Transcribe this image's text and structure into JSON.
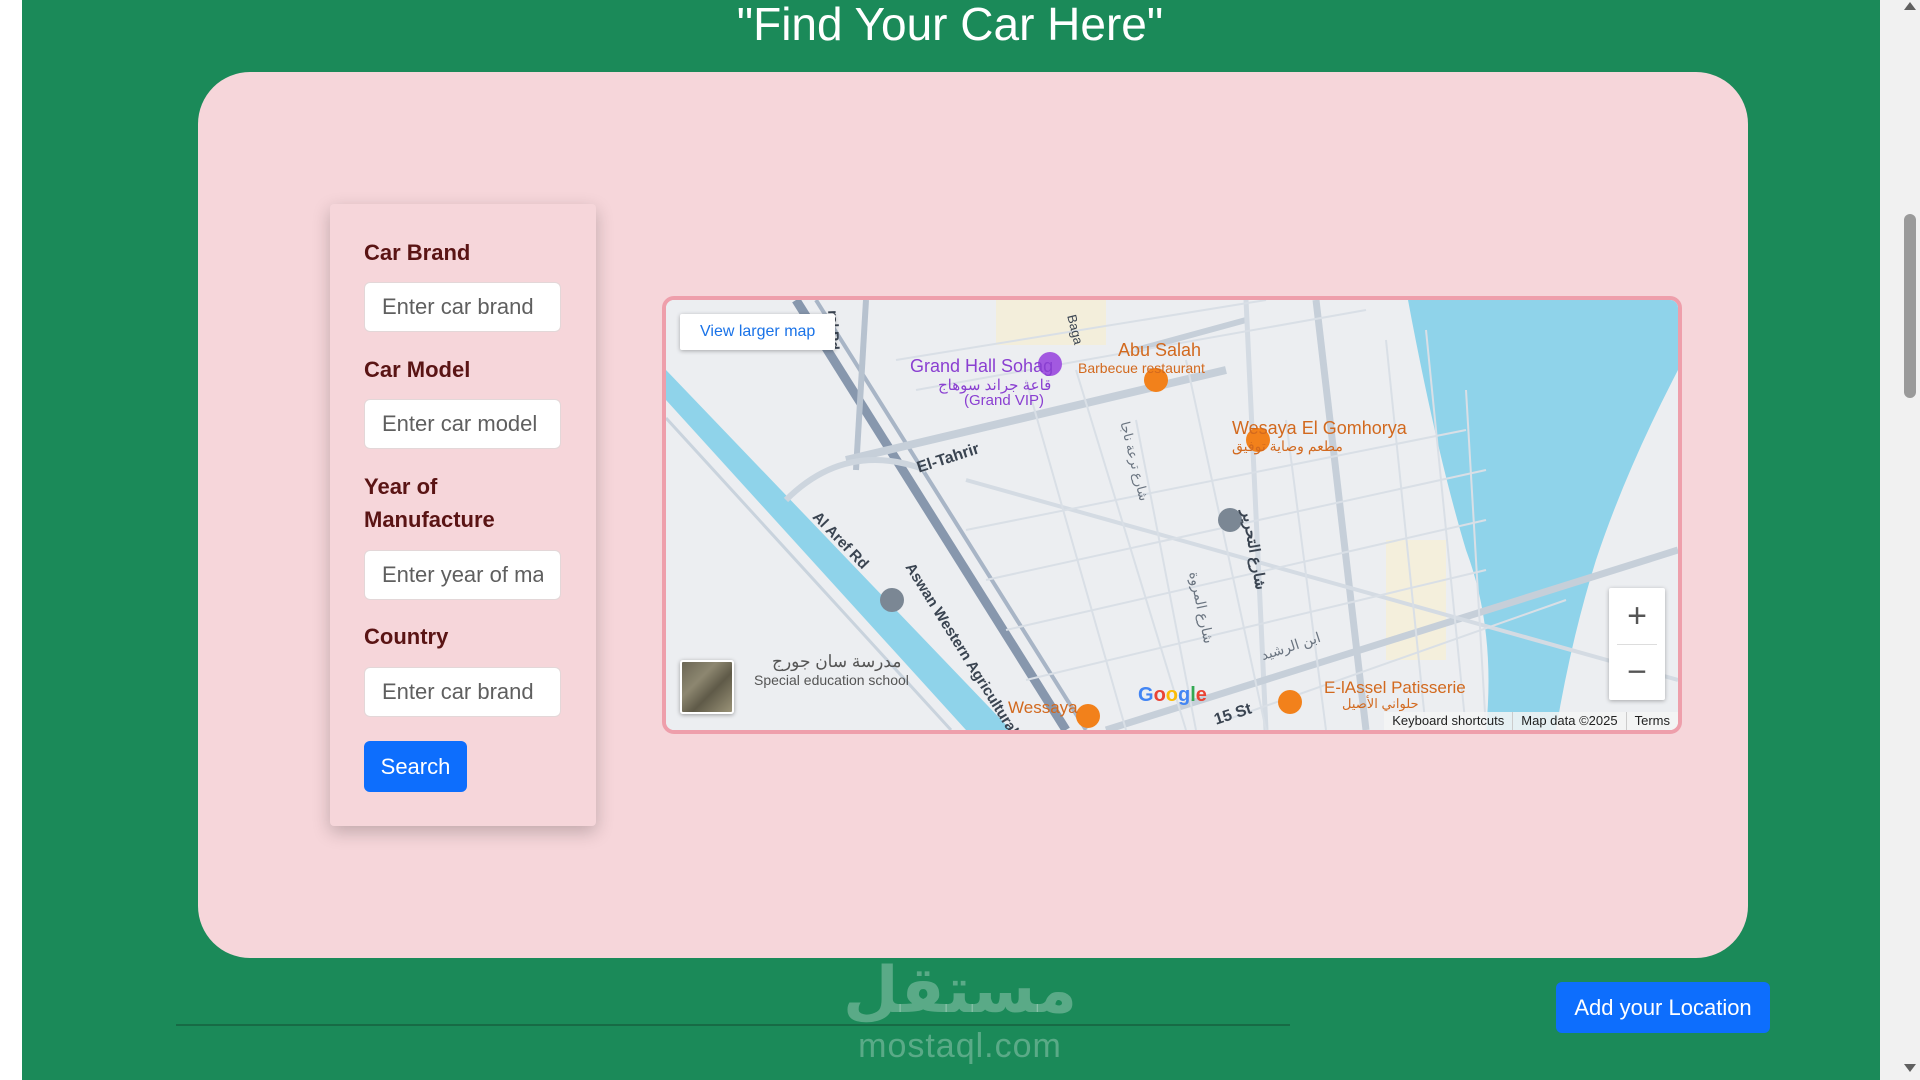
{
  "page": {
    "title": "\"Find Your Car Here\"",
    "bg_color": "#1b8a59",
    "card_color": "#f6d6da"
  },
  "form": {
    "brand_label": "Car Brand",
    "brand_placeholder": "Enter car brand",
    "model_label": "Car Model",
    "model_placeholder": "Enter car model",
    "year_label": "Year of Manufacture",
    "year_placeholder": "Enter year of manufacture",
    "country_label": "Country",
    "country_placeholder": "Enter car brand",
    "search_label": "Search"
  },
  "map": {
    "view_larger": "View larger map",
    "zoom_in": "+",
    "zoom_out": "−",
    "google": "Google",
    "attribution": {
      "keyboard": "Keyboard shortcuts",
      "data": "Map data ©2025",
      "terms": "Terms"
    },
    "places": {
      "grand_hall": "Grand Hall Sohag",
      "grand_hall_ar": "قاعة جراند سوهاج",
      "grand_hall_sub": "(Grand VIP)",
      "abu_salah": "Abu Salah",
      "abu_salah_sub": "Barbecue restaurant",
      "wesaya": "Wesaya El Gomhorya",
      "wesaya_ar": "مطعم وصاية توفيق",
      "school_ar": "مدرسة سان جورج",
      "school": "Special education school",
      "wessaya": "Wessaya",
      "patisserie": "E-lAssel Patisserie",
      "patisserie_ar": "حلواني الأصيل"
    },
    "roads": {
      "el_tahrir": "El-Tahrir",
      "aswan": "Aswan Western Agricultural Rd",
      "al_aref": "Al Aref Rd",
      "st15": "15 St",
      "ral_rd": "ral Rd",
      "baga": "Baga",
      "tahrir_ar": "شارع التحرير",
      "marwa_ar": "شارع المروة",
      "rashid_ar": "ابن الرشيد",
      "street_ar": "شارع ترعة ناجا"
    }
  },
  "footer": {
    "add_location": "Add your Location",
    "watermark_ar": "مستقل",
    "watermark_en": "mostaql.com"
  }
}
